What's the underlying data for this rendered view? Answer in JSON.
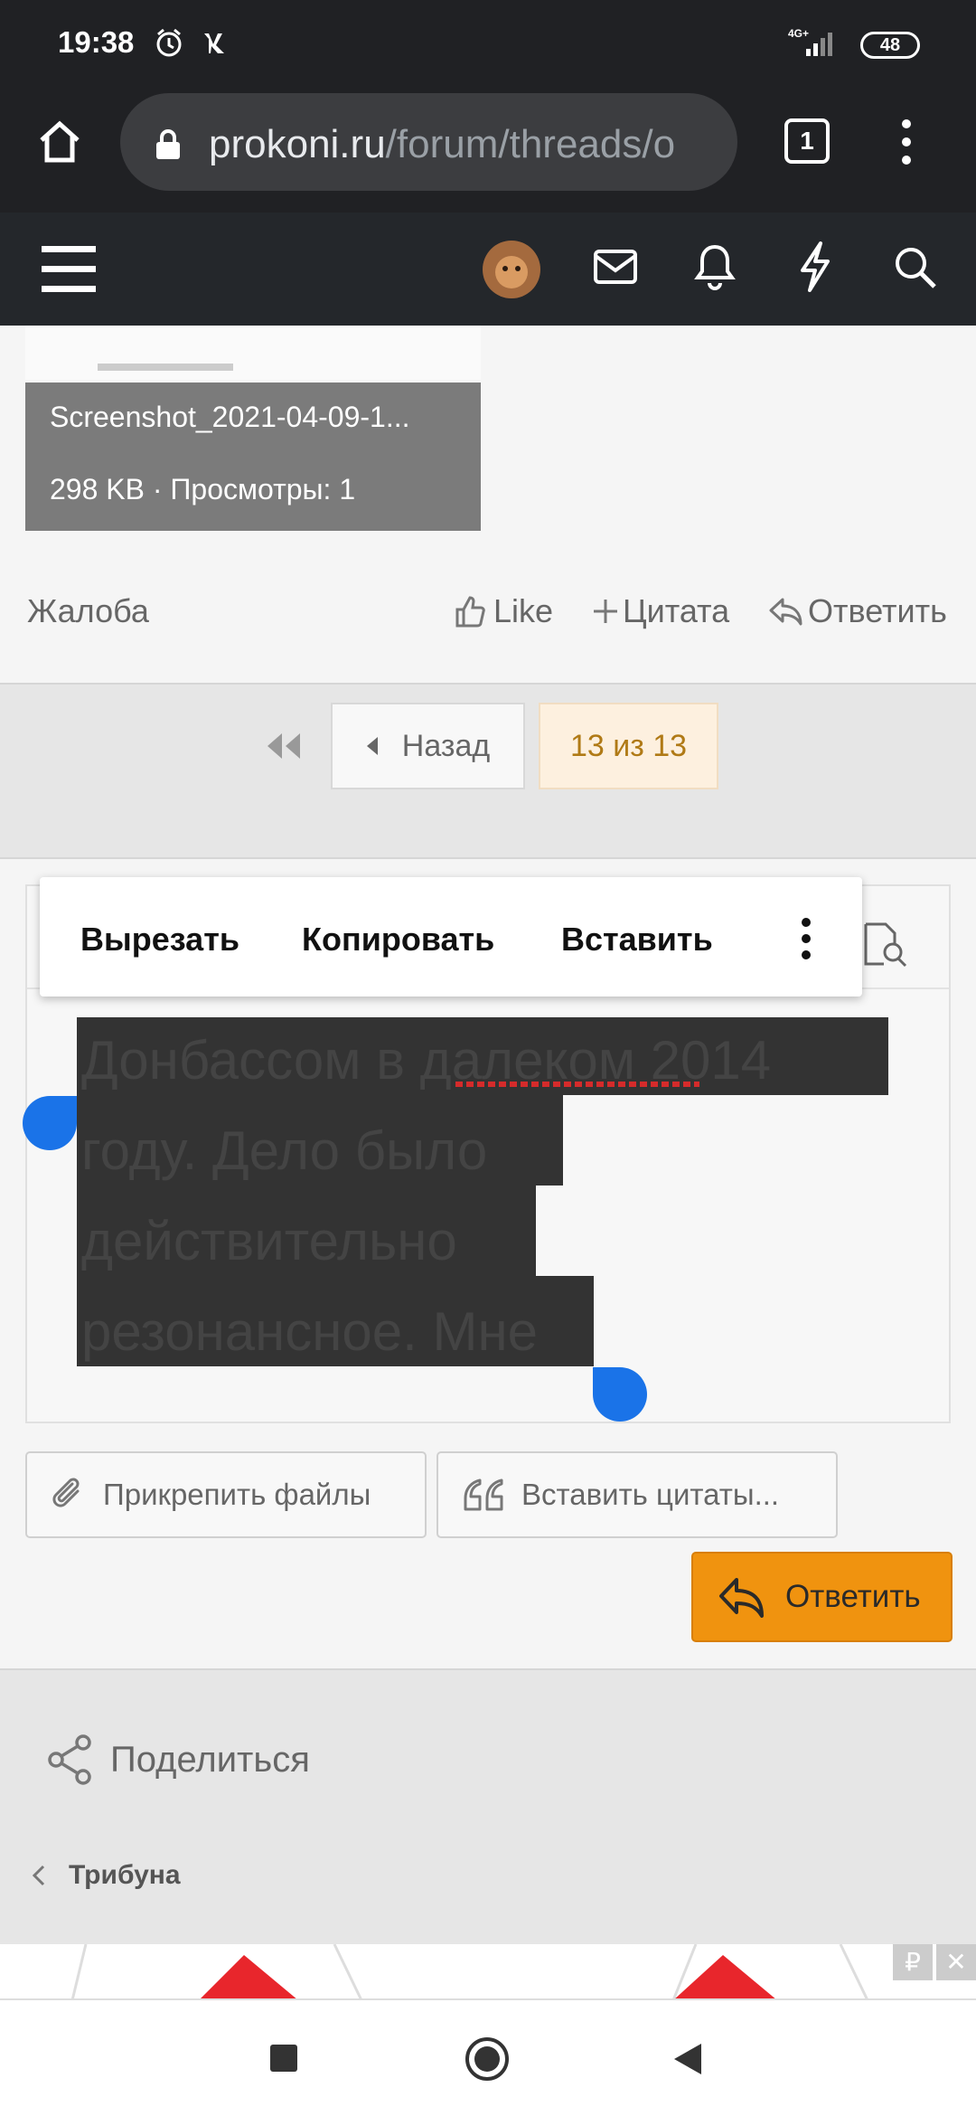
{
  "status_bar": {
    "time": "19:38",
    "network": "4G+",
    "battery": "48"
  },
  "browser": {
    "url_domain": "prokoni.ru",
    "url_path": "/forum/threads/o",
    "tab_count": "1"
  },
  "attachment": {
    "filename": "Screenshot_2021-04-09-1...",
    "meta": "298 KB · Просмотры: 1"
  },
  "post_actions": {
    "report": "Жалоба",
    "like": "Like",
    "quote": "Цитата",
    "reply": "Ответить"
  },
  "pagination": {
    "back": "Назад",
    "current": "13 из 13"
  },
  "context_menu": {
    "cut": "Вырезать",
    "copy": "Копировать",
    "paste": "Вставить"
  },
  "editor": {
    "lines": [
      "Донбассом в далеком 2014",
      "году. Дело было",
      "действительно",
      "резонансное. Мне"
    ]
  },
  "editor_buttons": {
    "attach": "Прикрепить файлы",
    "insert_quotes": "Вставить цитаты...",
    "reply": "Ответить"
  },
  "footer": {
    "share": "Поделиться",
    "breadcrumb": "Трибуна"
  },
  "ad": {
    "currency": "₽",
    "close": "✕"
  },
  "colors": {
    "accent_orange": "#f0930f",
    "selection_handle": "#1a73e8",
    "header_bg": "#24272b",
    "pager_current": "#b07a16"
  }
}
